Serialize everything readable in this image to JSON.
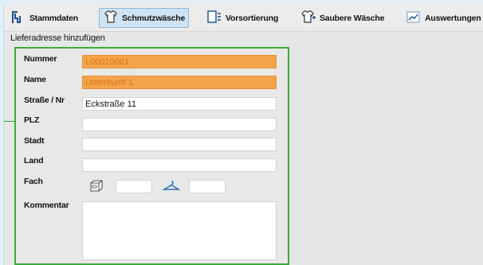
{
  "toolbar": {
    "items": [
      {
        "label": "Stammdaten",
        "icon": "hanger-rack-icon"
      },
      {
        "label": "Schmutzwäsche",
        "icon": "shirt-icon",
        "active": true
      },
      {
        "label": "Vorsortierung",
        "icon": "sort-icon"
      },
      {
        "label": "Saubere Wäsche",
        "icon": "clean-shirt-icon"
      },
      {
        "label": "Auswertungen",
        "icon": "report-icon"
      }
    ]
  },
  "page": {
    "subtitle": "Lieferadresse hinzufügen"
  },
  "form": {
    "nummer": {
      "label": "Nummer",
      "value": "L00010001"
    },
    "name": {
      "label": "Name",
      "value": "Unterkunft 1"
    },
    "strasse": {
      "label": "Straße / Nr",
      "value": "Eckstraße 11"
    },
    "plz": {
      "label": "PLZ",
      "value": ""
    },
    "stadt": {
      "label": "Stadt",
      "value": ""
    },
    "land": {
      "label": "Land",
      "value": ""
    },
    "fach": {
      "label": "Fach",
      "cabinet_value": "",
      "hanger_value": ""
    },
    "kommentar": {
      "label": "Kommentar",
      "value": ""
    }
  },
  "colors": {
    "highlight": "#f5a44a",
    "panel_border": "#3bab3b",
    "active_tab": "#cfe3f3"
  }
}
